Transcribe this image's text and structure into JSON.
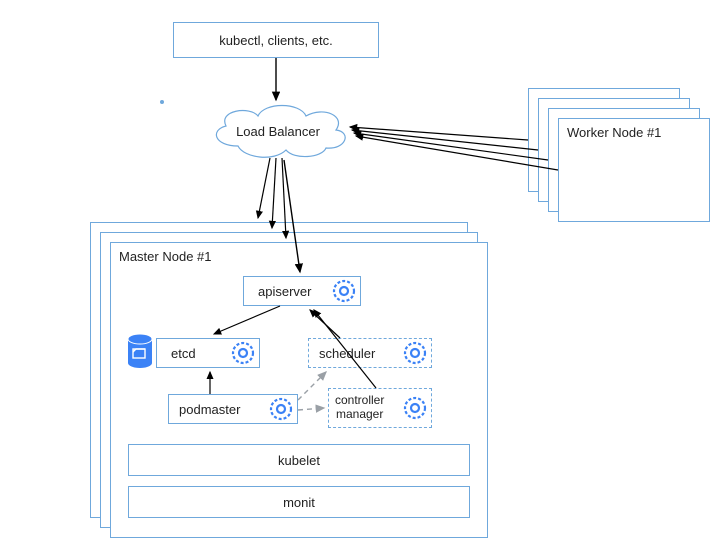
{
  "clients": {
    "label": "kubectl, clients, etc."
  },
  "load_balancer": {
    "label": "Load Balancer"
  },
  "worker": {
    "title": "Worker Node #1"
  },
  "master": {
    "title": "Master Node #1",
    "components": {
      "apiserver": "apiserver",
      "etcd": "etcd",
      "scheduler": "scheduler",
      "podmaster": "podmaster",
      "controller_manager": "controller\nmanager",
      "kubelet": "kubelet",
      "monit": "monit"
    }
  },
  "colors": {
    "accent": "#3b82f6",
    "border": "#6fa8dc"
  }
}
